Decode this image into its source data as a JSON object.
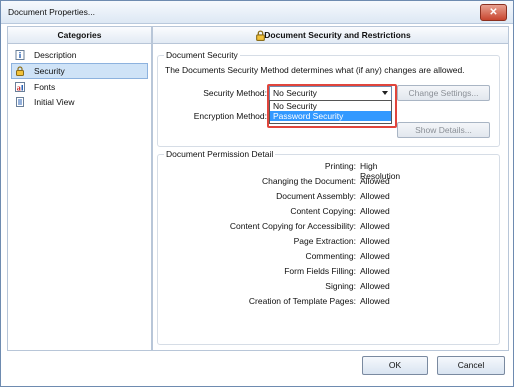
{
  "window": {
    "title": "Document Properties...",
    "close_glyph": "✕"
  },
  "categories": {
    "header": "Categories",
    "items": [
      {
        "label": "Description",
        "icon": "info-icon",
        "selected": false
      },
      {
        "label": "Security",
        "icon": "lock-icon",
        "selected": true
      },
      {
        "label": "Fonts",
        "icon": "font-icon",
        "selected": false
      },
      {
        "label": "Initial View",
        "icon": "document-icon",
        "selected": false
      }
    ]
  },
  "main": {
    "header": "Document Security and Restrictions",
    "security": {
      "group_label": "Document Security",
      "description": "The Documents Security Method determines what (if any) changes are allowed.",
      "method_label": "Security Method:",
      "method_value": "No Security",
      "options": [
        "No Security",
        "Password Security"
      ],
      "highlighted_option": "Password Security",
      "encryption_label": "Encryption Method:",
      "change_settings": "Change Settings...",
      "show_details": "Show Details..."
    },
    "permissions": {
      "group_label": "Document Permission Detail",
      "rows": [
        {
          "label": "Printing:",
          "value": "High Resolution"
        },
        {
          "label": "Changing the Document:",
          "value": "Allowed"
        },
        {
          "label": "Document Assembly:",
          "value": "Allowed"
        },
        {
          "label": "Content Copying:",
          "value": "Allowed"
        },
        {
          "label": "Content Copying for Accessibility:",
          "value": "Allowed"
        },
        {
          "label": "Page Extraction:",
          "value": "Allowed"
        },
        {
          "label": "Commenting:",
          "value": "Allowed"
        },
        {
          "label": "Form Fields Filling:",
          "value": "Allowed"
        },
        {
          "label": "Signing:",
          "value": "Allowed"
        },
        {
          "label": "Creation of Template Pages:",
          "value": "Allowed"
        }
      ]
    }
  },
  "footer": {
    "ok": "OK",
    "cancel": "Cancel"
  },
  "colors": {
    "highlight": "#3399ff",
    "callout": "#e0453c",
    "selected_bg": "#cfe3f7"
  }
}
